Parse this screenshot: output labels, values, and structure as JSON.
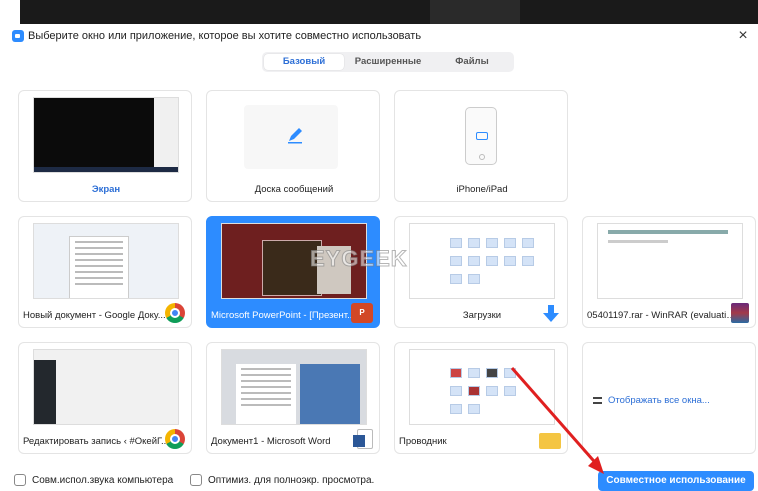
{
  "window": {
    "title": "Выберите окно или приложение, которое вы хотите совместно использовать",
    "close_glyph": "×"
  },
  "tabs": [
    {
      "label": "Базовый",
      "active": true
    },
    {
      "label": "Расширенные",
      "active": false
    },
    {
      "label": "Файлы",
      "active": false
    }
  ],
  "tiles": [
    {
      "label": "Экран",
      "kind": "screen"
    },
    {
      "label": "Доска сообщений",
      "kind": "whiteboard",
      "icon": "pen-icon"
    },
    {
      "label": "iPhone/iPad",
      "kind": "iphone",
      "icon": "phone-icon"
    },
    {
      "label": "Новый документ - Google Доку...",
      "kind": "window",
      "icon": "chrome-icon"
    },
    {
      "label": "Microsoft PowerPoint - [Презент...",
      "kind": "window",
      "icon": "powerpoint-icon",
      "selected": true
    },
    {
      "label": "Загрузки",
      "kind": "window",
      "icon": "download-arrow-icon"
    },
    {
      "label": "05401197.rar - WinRAR (evaluatio...",
      "kind": "window",
      "icon": "winrar-icon"
    },
    {
      "label": "Редактировать запись ‹ #ОкейГ...",
      "kind": "window",
      "icon": "chrome-icon"
    },
    {
      "label": "Документ1 - Microsoft Word",
      "kind": "window",
      "icon": "word-icon"
    },
    {
      "label": "Проводник",
      "kind": "window",
      "icon": "folder-icon"
    },
    {
      "label": "Отображать все окна...",
      "kind": "show-all",
      "icon": "list-icon"
    }
  ],
  "watermark": "EYGEEK",
  "footer": {
    "share_audio": "Совм.испол.звука компьютера",
    "optimize": "Оптимиз. для полноэкр. просмотра.",
    "share_button": "Совместное использование"
  },
  "colors": {
    "accent": "#2d8cff",
    "annotation_arrow": "#e02020"
  }
}
